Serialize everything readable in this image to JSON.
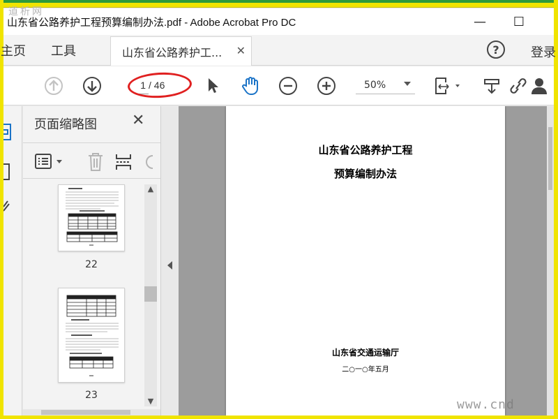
{
  "watermarks": {
    "top": "道析网",
    "bottom": "www.cnd"
  },
  "window": {
    "title": "山东省公路养护工程预算编制办法.pdf - Adobe Acrobat Pro DC",
    "minimize": "—",
    "maximize": "☐"
  },
  "tabs": {
    "home": "主页",
    "tools": "工具",
    "document": "山东省公路养护工...",
    "document_close": "✕",
    "help": "?",
    "login": "登录"
  },
  "toolbar": {
    "current_page": "1",
    "total_pages": "/ 46",
    "zoom": "50%"
  },
  "thumbnail_panel": {
    "title": "页面缩略图",
    "close": "✕",
    "pages": [
      {
        "number": "22"
      },
      {
        "number": "23"
      }
    ]
  },
  "document": {
    "title_line1": "山东省公路养护工程",
    "title_line2": "预算编制办法",
    "organization": "山东省交通运输厅",
    "date": "二○一○年五月"
  },
  "colors": {
    "highlight_oval": "#e02020",
    "frame": "#f0e400",
    "frame_accent": "#2e9a3b"
  }
}
